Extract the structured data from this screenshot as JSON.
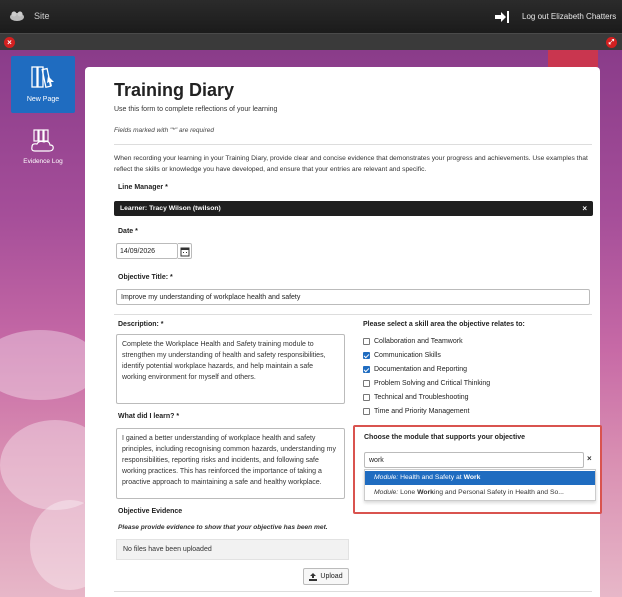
{
  "topbar": {
    "site": "Site",
    "logout": "Log out Elizabeth Chatters"
  },
  "sidebar": {
    "items": [
      {
        "label": "New Page"
      },
      {
        "label": "Evidence Log"
      }
    ]
  },
  "form": {
    "title": "Training Diary",
    "intro": "Use this form to complete reflections of your learning",
    "required_note": "Fields marked with \"*\" are required",
    "guidance": "When recording your learning in your Training Diary, provide clear and concise evidence that demonstrates your progress and achievements. Use examples that reflect the skills or knowledge you have developed, and ensure that your entries are relevant and specific.",
    "line_manager": {
      "label": "Line Manager *",
      "value": "Learner: Tracy Wilson (twilson)",
      "remove": "×"
    },
    "date": {
      "label": "Date *",
      "value": "14/09/2026"
    },
    "objective_title": {
      "label": "Objective Title: *",
      "value": "Improve my understanding of workplace health and safety"
    },
    "description": {
      "label": "Description: *",
      "value": "Complete the Workplace Health and Safety training module to strengthen my understanding of health and safety responsibilities, identify potential workplace hazards, and help maintain a safe working environment for myself and others."
    },
    "learned": {
      "label": "What did I learn? *",
      "value": "I gained a better understanding of workplace health and safety principles, including recognising common hazards, understanding my responsibilities, reporting risks and incidents, and following safe working practices. This has reinforced the importance of taking a proactive approach to maintaining a safe and healthy workplace."
    },
    "skills": {
      "label": "Please select a skill area the objective relates to:",
      "options": [
        {
          "label": "Collaboration and Teamwork",
          "checked": false
        },
        {
          "label": "Communication Skills",
          "checked": true
        },
        {
          "label": "Documentation and Reporting",
          "checked": true
        },
        {
          "label": "Problem Solving and Critical Thinking",
          "checked": false
        },
        {
          "label": "Technical and Troubleshooting",
          "checked": false
        },
        {
          "label": "Time and Priority Management",
          "checked": false
        }
      ]
    },
    "module": {
      "label": "Choose the module that supports your objective",
      "search_value": "work",
      "clear": "×",
      "results": [
        {
          "prefix": "Module:",
          "before": " Health and Safety at ",
          "match": "Work",
          "after": ""
        },
        {
          "prefix": "Module:",
          "before": " Lone ",
          "match": "Work",
          "after": "ing and Personal Safety in Health and So..."
        }
      ]
    },
    "evidence": {
      "label": "Objective Evidence",
      "note": "Please provide evidence to show that your objective has been met.",
      "files": "No files have been uploaded",
      "upload": "Upload"
    }
  }
}
